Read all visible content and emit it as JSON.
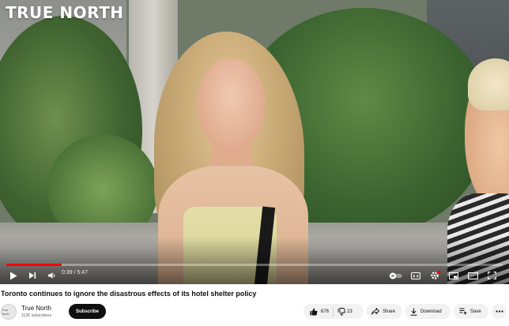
{
  "video": {
    "logo_text": "TRUE NORTH",
    "current_time": "0:39",
    "duration": "5:47",
    "time_display": "0:39 / 5:47",
    "progress_fraction": 0.112,
    "progress_color": "#ff0000",
    "controls": [
      "play-icon",
      "next-icon",
      "volume-icon",
      "autoplay-toggle-icon",
      "captions-icon",
      "settings-icon",
      "miniplayer-icon",
      "theater-icon",
      "fullscreen-icon"
    ]
  },
  "title": "Toronto continues to ignore the disastrous effects of its hotel shelter policy",
  "channel": {
    "avatar_text": "True North",
    "name": "True North",
    "subscribers": "112K subscribers",
    "subscribe_label": "Subscribe"
  },
  "actions": {
    "like_count": "676",
    "dislike_count": "23",
    "share_label": "Share",
    "download_label": "Download",
    "save_label": "Save",
    "more_icon": "more-horizontal-icon"
  }
}
